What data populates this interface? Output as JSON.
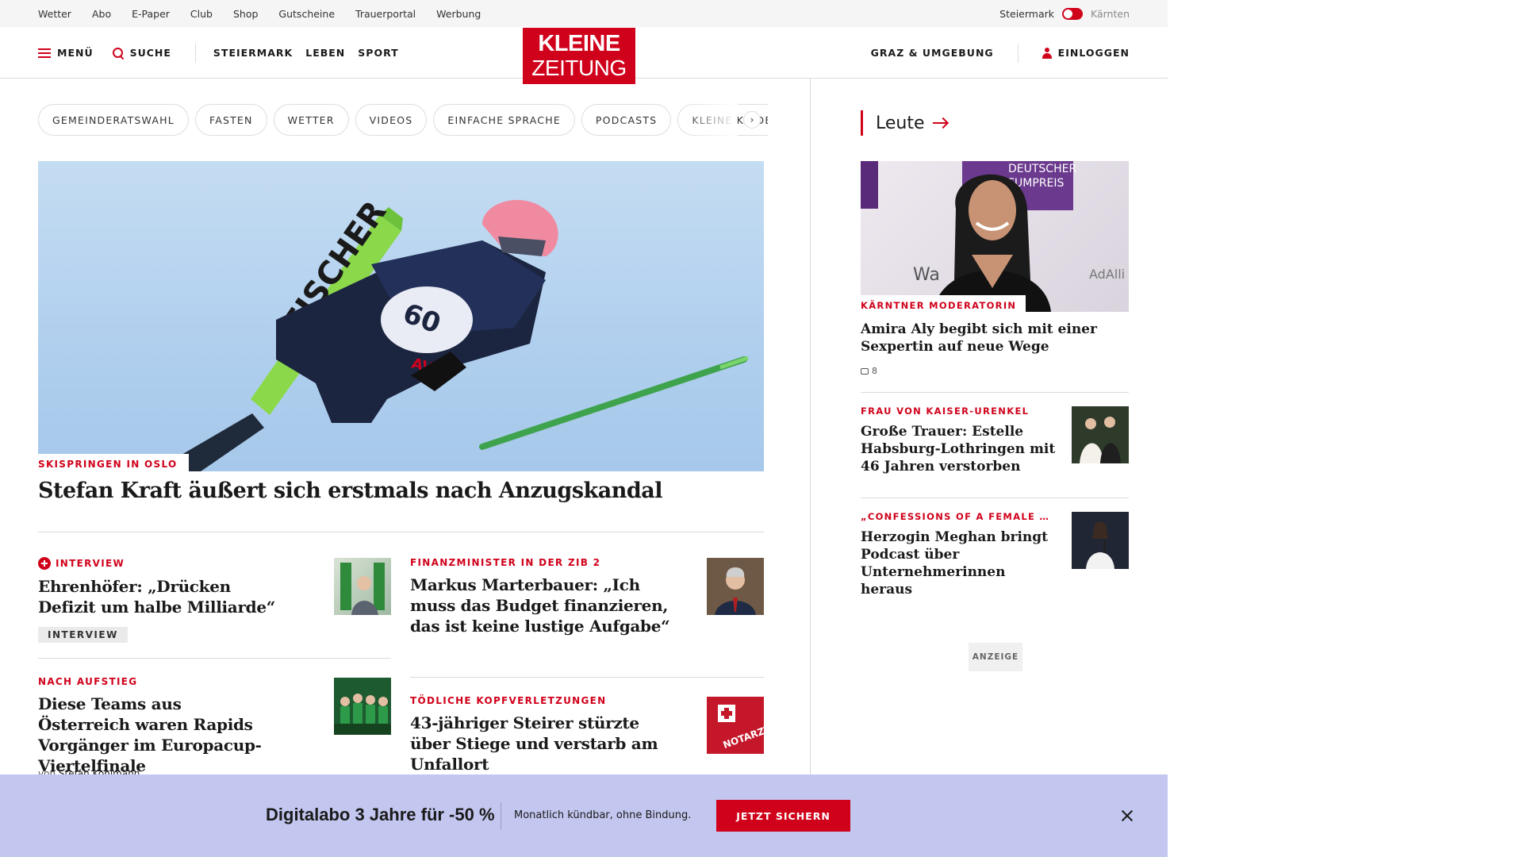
{
  "utility_nav": [
    "Wetter",
    "Abo",
    "E-Paper",
    "Club",
    "Shop",
    "Gutscheine",
    "Trauerportal",
    "Werbung"
  ],
  "region_switch": {
    "active": "Steiermark",
    "inactive": "Kärnten"
  },
  "header": {
    "menu_label": "MENÜ",
    "search_label": "SUCHE",
    "sections": [
      "STEIERMARK",
      "LEBEN",
      "SPORT"
    ],
    "logo_line1": "KLEINE",
    "logo_line2": "ZEITUNG",
    "region_label": "GRAZ & UMGEBUNG",
    "login_label": "EINLOGGEN"
  },
  "chips": [
    "GEMEINDERATSWAHL",
    "FASTEN",
    "WETTER",
    "VIDEOS",
    "EINFACHE SPRACHE",
    "PODCASTS",
    "KLEINE KINDER"
  ],
  "hero": {
    "kicker": "SKISPRINGEN IN OSLO",
    "title": "Stefan Kraft äußert sich erstmals nach Anzugskandal",
    "image_text": {
      "ski": "FISCHER",
      "bib": "60",
      "sponsor": "AVA"
    }
  },
  "articles": [
    {
      "kicker": "INTERVIEW",
      "title": "Ehrenhöfer: „Drücken Defizit um halbe Milliarde“",
      "tag": "INTERVIEW"
    },
    {
      "kicker": "FINANZMINISTER IN DER ZIB 2",
      "title": "Markus Marterbauer: „Ich muss das Budget finanzieren, das ist keine lustige Aufgabe“"
    },
    {
      "kicker": "NACH AUFSTIEG",
      "title": "Diese Teams aus Österreich waren Rapids Vorgänger im Europacup-Viertelfinale",
      "byline_prefix": "von",
      "byline_author": "Stefan Kohlmann"
    },
    {
      "kicker": "TÖDLICHE KOPFVERLETZUNGEN",
      "title": "43-jähriger Steirer stürzte über Stiege und verstarb am Unfallort",
      "image_text": "NOTARZT"
    }
  ],
  "sidebar": {
    "title": "Leute",
    "featured": {
      "kicker": "KÄRNTNER MODERATORIN",
      "title": "Amira Aly begibt sich mit einer Sexpertin auf neue Wege",
      "comments": "8",
      "image_text": {
        "line1": "DEUTSCHER",
        "line2": "FUMPREIS",
        "left": "Wa",
        "right": "AdAlli"
      }
    },
    "items": [
      {
        "kicker": "FRAU VON KAISER-URENKEL",
        "title": "Große Trauer: Estelle Habsburg-Lothringen mit 46 Jahren verstorben"
      },
      {
        "kicker": "„CONFESSIONS OF A FEMALE …",
        "title": "Herzogin Meghan bringt Podcast über Unternehmerinnen heraus"
      }
    ],
    "ad_label": "ANZEIGE"
  },
  "promo": {
    "title": "Digitalabo 3 Jahre für -50 %",
    "subtitle": "Monatlich kündbar, ohne Bindung.",
    "button": "JETZT SICHERN"
  },
  "colors": {
    "brand_red": "#d0021b",
    "promo_bg": "#c3c6ef",
    "divider": "#dadada"
  }
}
